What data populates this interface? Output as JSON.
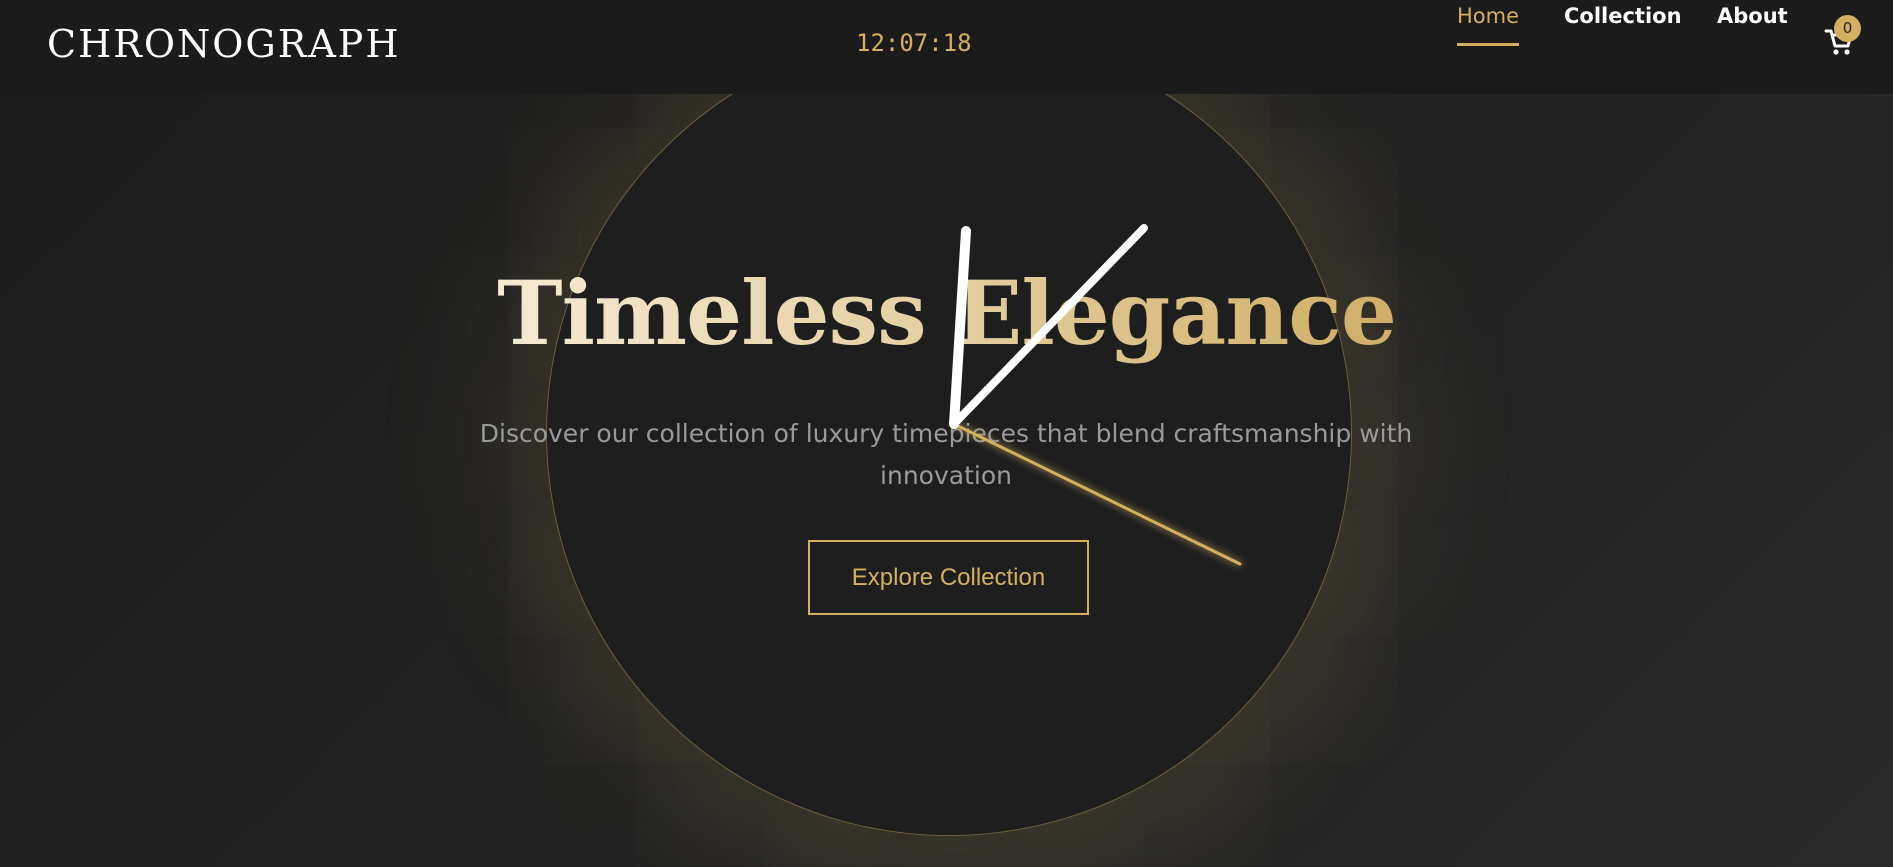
{
  "brand": {
    "logo": "CHRONOGRAPH"
  },
  "header": {
    "time": "12:07:18",
    "nav": [
      {
        "label": "Home",
        "active": true
      },
      {
        "label": "Collection",
        "active": false
      },
      {
        "label": "About",
        "active": false
      }
    ],
    "cart": {
      "icon": "cart-icon",
      "count": "0"
    }
  },
  "hero": {
    "title": "Timeless Elegance",
    "subtitle": "Discover our collection of luxury timepieces that blend craftsmanship with innovation",
    "cta_label": "Explore Collection"
  },
  "colors": {
    "accent": "#d4af60",
    "background": "#222222",
    "header": "#1b1b1b",
    "text_light": "#ffffff",
    "text_muted": "#9a9a9a"
  }
}
